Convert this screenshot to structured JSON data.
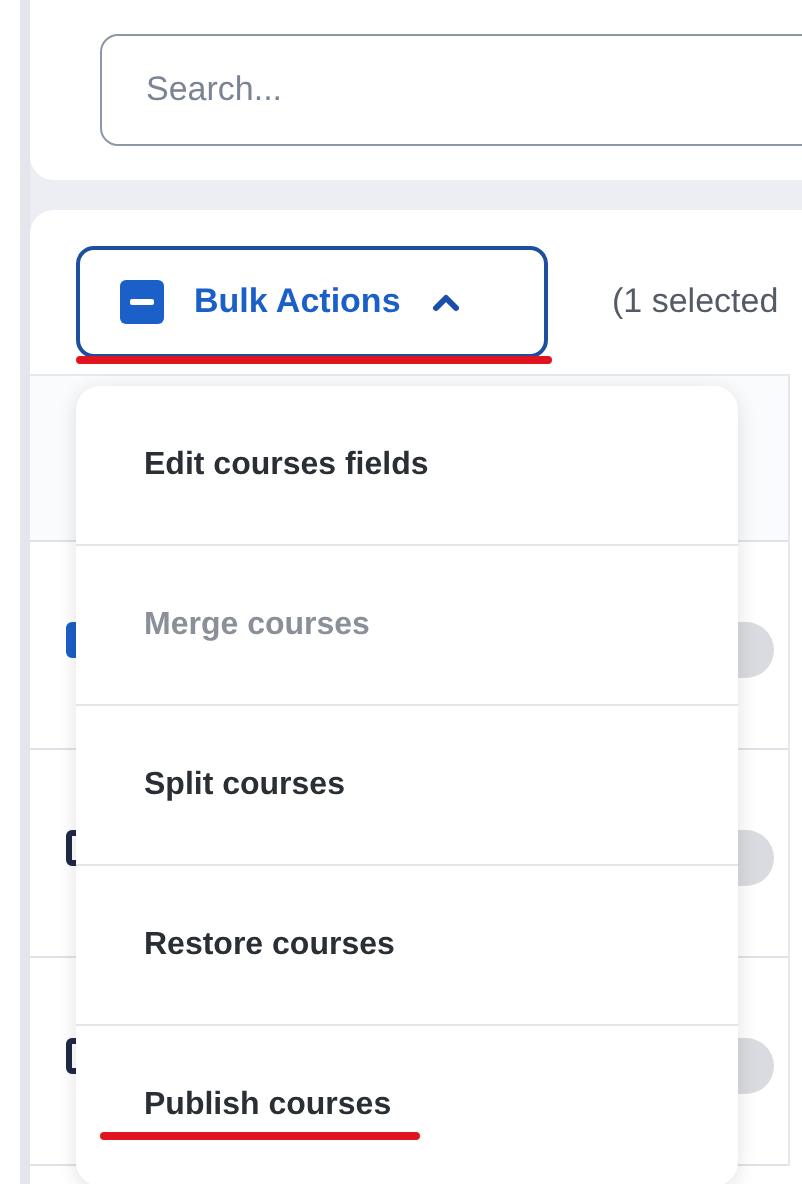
{
  "search": {
    "placeholder": "Search..."
  },
  "bulk_actions": {
    "label": "Bulk Actions",
    "expanded": true,
    "underlined": true
  },
  "selection_count": "(1 selected",
  "rows": [
    {
      "selected": true
    },
    {
      "selected": false
    },
    {
      "selected": false
    }
  ],
  "menu": [
    {
      "label": "Edit courses fields",
      "disabled": false,
      "underlined": false
    },
    {
      "label": "Merge courses",
      "disabled": true,
      "underlined": false
    },
    {
      "label": "Split courses",
      "disabled": false,
      "underlined": false
    },
    {
      "label": "Restore courses",
      "disabled": false,
      "underlined": false
    },
    {
      "label": "Publish courses",
      "disabled": false,
      "underlined": true
    }
  ]
}
